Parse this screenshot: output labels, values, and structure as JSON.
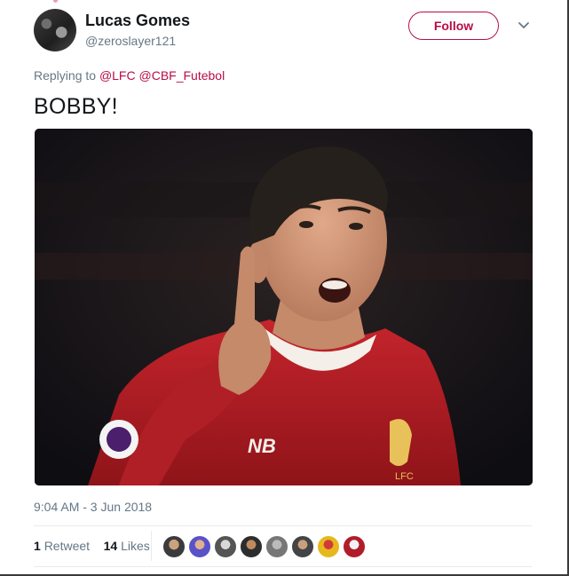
{
  "author": {
    "name": "Lucas Gomes",
    "handle": "@zeroslayer121"
  },
  "follow_label": "Follow",
  "reply": {
    "prefix": "Replying to",
    "mentions": [
      "@LFC",
      "@CBF_Futebol"
    ]
  },
  "tweet_text": "BOBBY!",
  "media": {
    "kit_brand": "NB",
    "crest_text": "LFC"
  },
  "timestamp": "9:04 AM - 3 Jun 2018",
  "stats": {
    "retweets_count": "1",
    "retweets_label": "Retweet",
    "likes_count": "14",
    "likes_label": "Likes"
  },
  "colors": {
    "accent": "#b80d47",
    "secondary_text": "#657786",
    "primary_text": "#14171a",
    "divider": "#e6ecf0"
  },
  "icons": {
    "chevron": "chevron-down-icon"
  }
}
